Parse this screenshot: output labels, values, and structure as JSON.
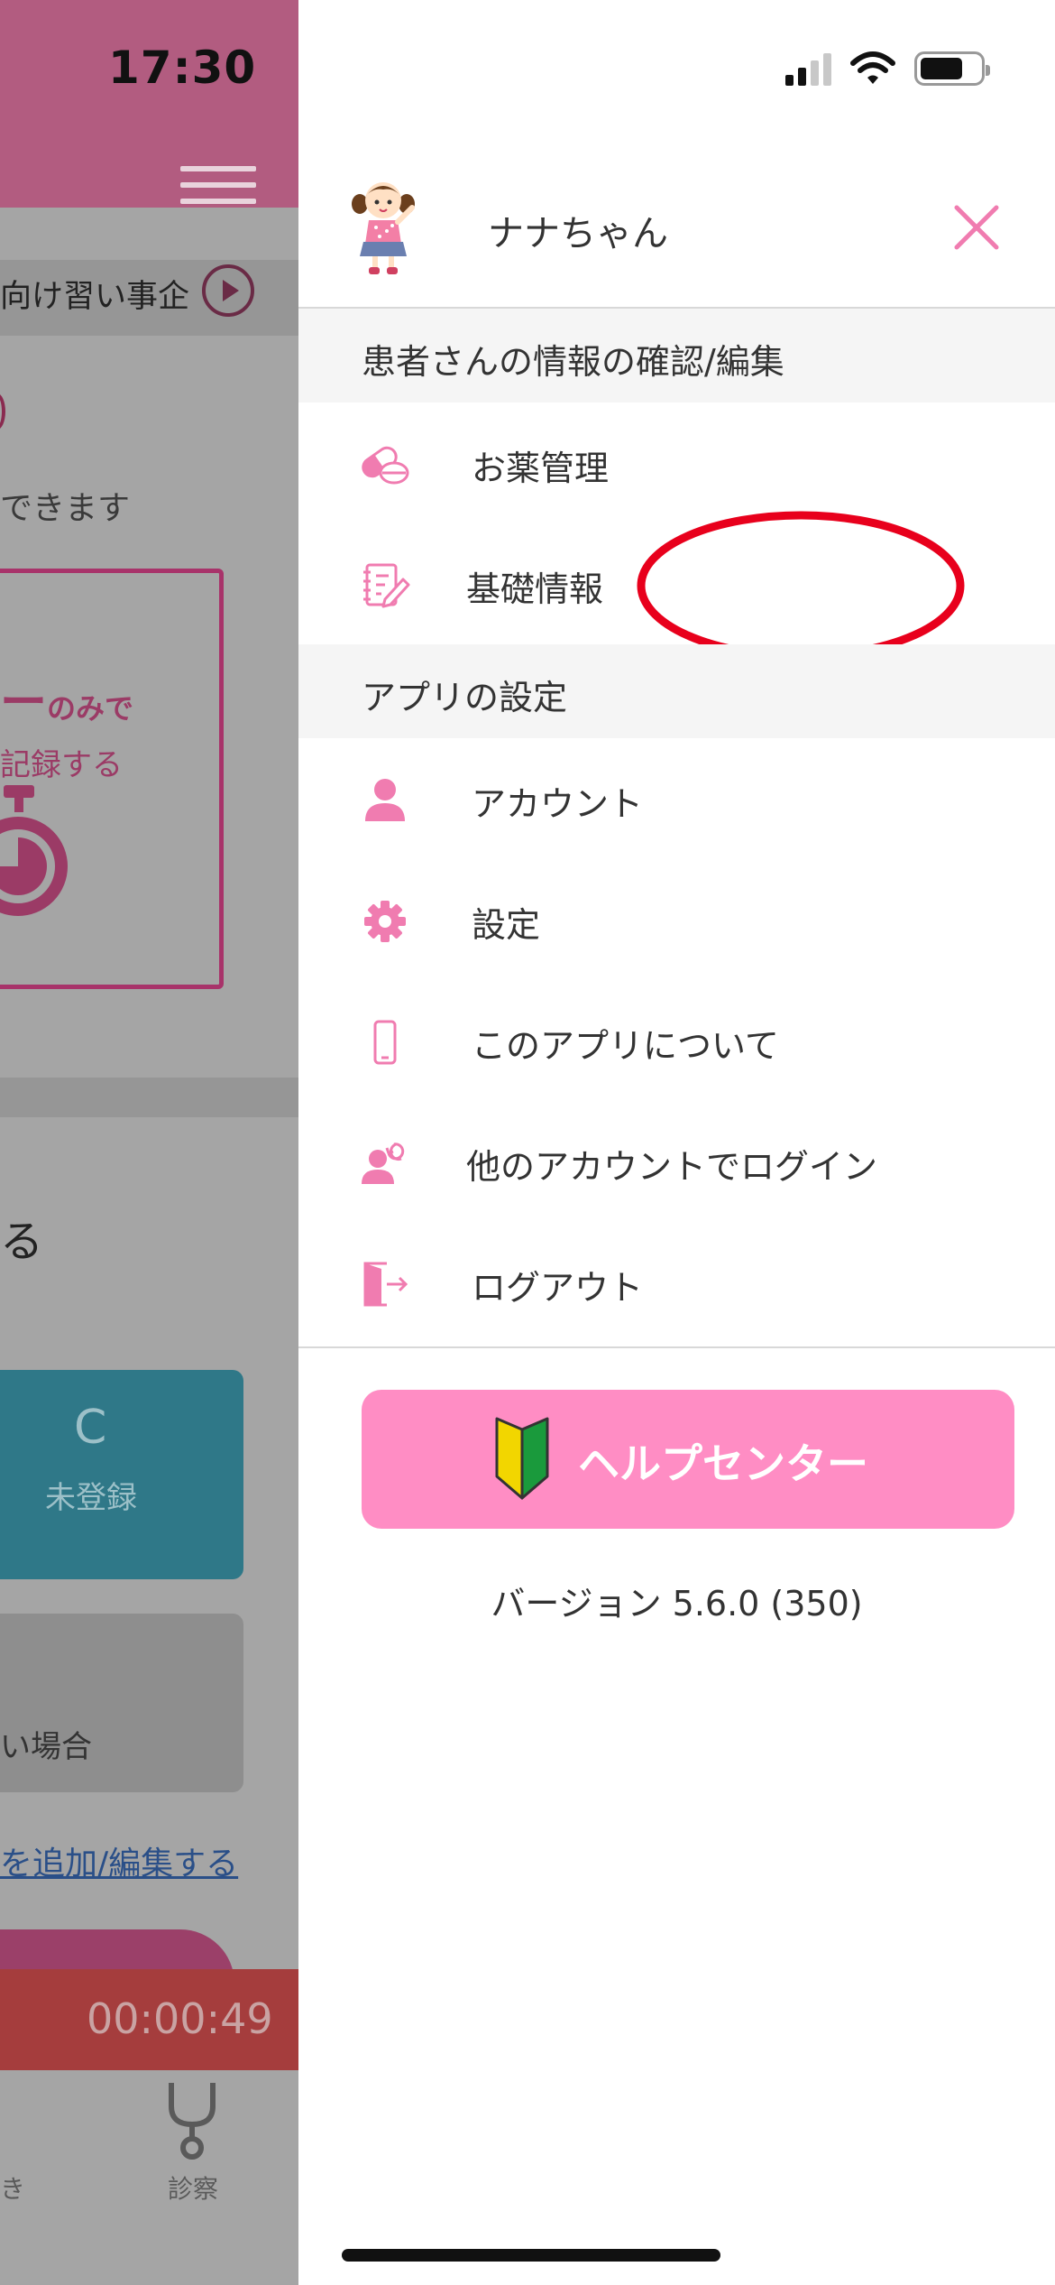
{
  "status_bar": {
    "time": "17:30"
  },
  "background": {
    "ticker_text": "向け習い事企",
    "can_text": "できます",
    "card_line1_big": "ー",
    "card_line1_small": "のみで",
    "card_line2": "記録する",
    "section_fragment": "る",
    "teal_card_letter": "C",
    "teal_card_label": "未登録",
    "gray_card_label": "い場合",
    "link_text": "を追加/編集する",
    "timer": "00:00:49",
    "tab_label": "診察",
    "tab_left_label": "き"
  },
  "drawer": {
    "child_name": "ナナちゃん",
    "sections": {
      "patient": "患者さんの情報の確認/編集",
      "app_settings": "アプリの設定"
    },
    "menu": {
      "medicine": "お薬管理",
      "basic_info": "基礎情報",
      "account": "アカウント",
      "settings": "設定",
      "about": "このアプリについて",
      "switch_account": "他のアカウントでログイン",
      "logout": "ログアウト"
    },
    "help_center": "ヘルプセンター",
    "version_label": "バージョン",
    "version_value": "5.6.0 (350)"
  },
  "colors": {
    "accent_pink": "#ff8dc4",
    "icon_pink": "#f07cb0",
    "highlight_red": "#e8001c"
  },
  "icons": [
    "pill-icon",
    "notes-edit-icon",
    "person-icon",
    "gear-icon",
    "smartphone-icon",
    "person-switch-icon",
    "logout-door-icon",
    "beginner-mark-icon",
    "close-icon"
  ]
}
